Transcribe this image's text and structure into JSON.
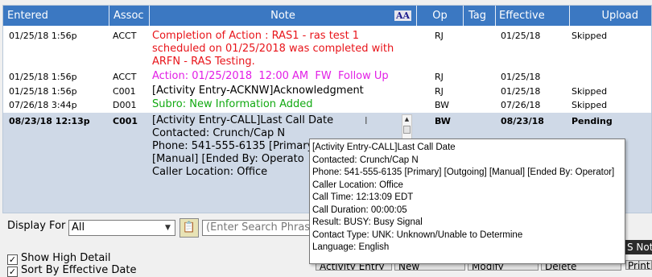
{
  "columns": {
    "entered": "Entered",
    "assoc": "Assoc",
    "note": "Note",
    "font_toggle": "AA",
    "op": "Op",
    "tag": "Tag",
    "effective": "Effective",
    "upload": "Upload"
  },
  "rows": [
    {
      "entered": "01/25/18 1:56p",
      "assoc": "ACCT",
      "note": "Completion of Action : RAS1 - ras test 1 scheduled on 01/25/2018 was completed with ARFN - RAS Testing.",
      "note_color": "#e8141a",
      "op": "RJ",
      "effective": "01/25/18",
      "upload": "Skipped"
    },
    {
      "entered": "01/25/18 1:56p",
      "assoc": "ACCT",
      "note": "Action: 01/25/2018  12:00 AM  FW  Follow Up",
      "note_color": "#e21ee6",
      "op": "RJ",
      "effective": "01/25/18",
      "upload": ""
    },
    {
      "entered": "01/25/18 1:56p",
      "assoc": "C001",
      "note": "[Activity Entry-ACKNW]Acknowledgment",
      "note_color": "#000000",
      "op": "RJ",
      "effective": "01/25/18",
      "upload": "Skipped"
    },
    {
      "entered": "07/26/18 3:44p",
      "assoc": "D001",
      "note": "Subro: New Information Added",
      "note_color": "#11a911",
      "op": "BW",
      "effective": "07/26/18",
      "upload": "Skipped"
    },
    {
      "entered": "08/23/18 12:13p",
      "assoc": "C001",
      "note_lines": [
        "[Activity Entry-CALL]Last Call Date",
        "Contacted: Crunch/Cap N",
        "Phone: 541-555-6135 [Primary]",
        "[Manual] [Ended By: Operato",
        "Caller Location: Office"
      ],
      "op": "BW",
      "effective": "08/23/18",
      "upload": "Pending"
    }
  ],
  "tooltip": [
    "[Activity Entry-CALL]Last Call Date",
    "Contacted: Crunch/Cap N",
    "Phone: 541-555-6135 [Primary] [Outgoing] [Manual] [Ended By: Operator]",
    "Caller Location: Office",
    "Call Time: 12:13:09 EDT",
    "Call Duration: 00:00:05",
    "Result: BUSY: Busy Signal",
    "Contact Type: UNK: Unknown/Unable to Determine",
    "Language: English"
  ],
  "filter": {
    "label": "Display For",
    "selected": "All",
    "search_placeholder": "(Enter Search Phrase"
  },
  "checkboxes": {
    "show_high_detail": "Show High Detail",
    "show_high_detail_checked": true,
    "sort_effective": "Sort By Effective Date",
    "sort_effective_checked": true
  },
  "buttons": {
    "activity_entry": "Activity Entry",
    "new": "New",
    "modify": "Modify",
    "delete": "Delete",
    "print": "Print",
    "right_top": "S Not"
  },
  "icons": {
    "dropdown": "chevron-down-icon",
    "scroll_up": "scroll-up-icon",
    "clipboard": "clipboard-icon"
  }
}
